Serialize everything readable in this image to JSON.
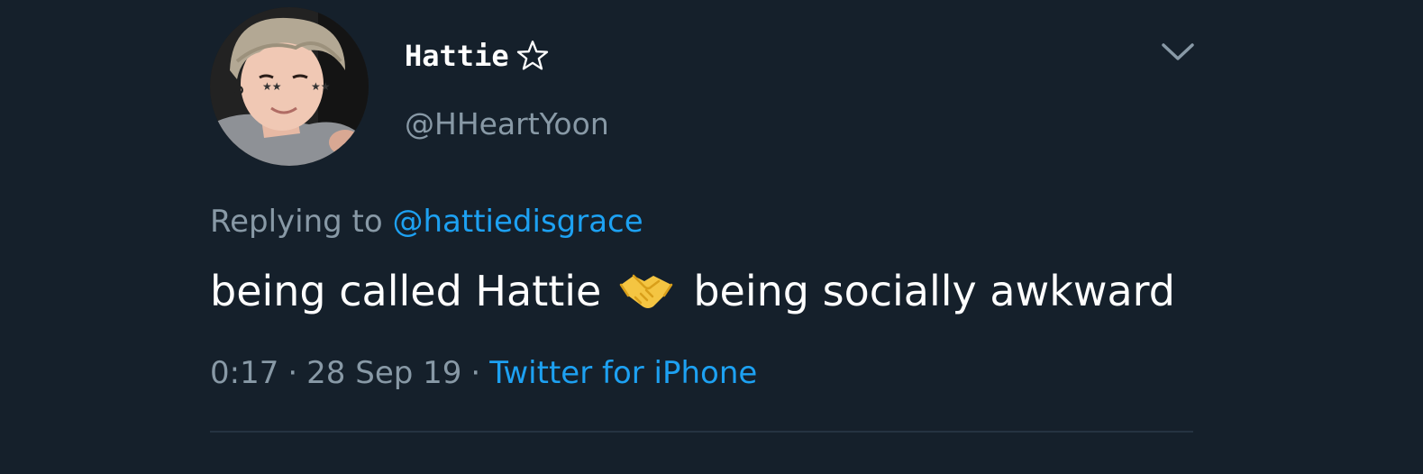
{
  "tweet": {
    "display_name": "Hattie",
    "handle": "@HHeartYoon",
    "replying_prefix": "Replying to ",
    "replying_to": "@hattiedisgrace",
    "text_before": "being called Hattie",
    "text_after": "being socially awkward",
    "time": "0:17",
    "date": "28 Sep 19",
    "separator": "·",
    "source": "Twitter for iPhone"
  },
  "icons": {
    "name_badge": "star-outline-icon",
    "menu": "chevron-down-icon",
    "emoji": "handshake-icon"
  },
  "colors": {
    "background": "#15202b",
    "secondary_text": "#8899a6",
    "link": "#1da1f2",
    "divider": "#253341"
  }
}
